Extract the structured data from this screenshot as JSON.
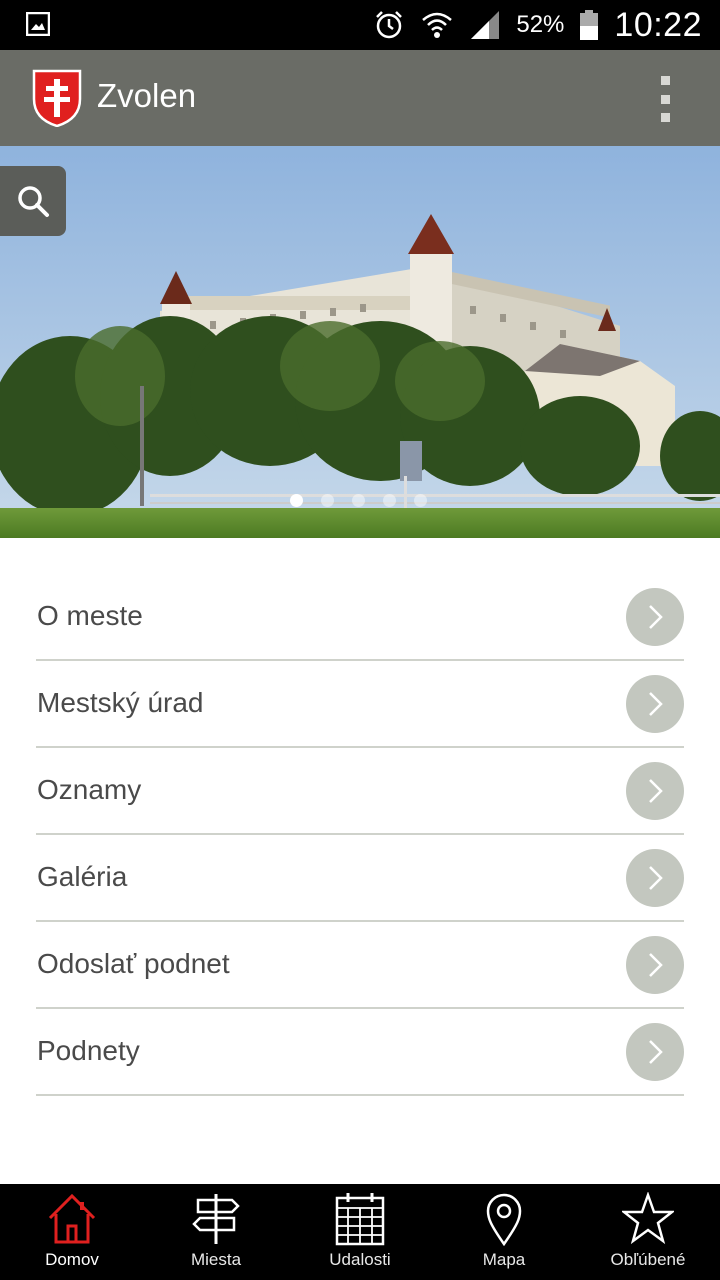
{
  "status_bar": {
    "icons": [
      "image-notification-icon",
      "alarm-icon",
      "wifi-icon",
      "signal-icon",
      "battery-icon"
    ],
    "battery": "52%",
    "time": "10:22"
  },
  "app_bar": {
    "title": "Zvolen",
    "logo": "coat-of-arms-icon",
    "menu_icon": "overflow-menu-icon"
  },
  "hero": {
    "search_icon": "search-icon",
    "slides_count": 5,
    "active_slide": 1
  },
  "menu": [
    {
      "label": "O meste"
    },
    {
      "label": "Mestský úrad"
    },
    {
      "label": "Oznamy"
    },
    {
      "label": "Galéria"
    },
    {
      "label": "Odoslať podnet"
    },
    {
      "label": "Podnety"
    }
  ],
  "bottom_nav": {
    "active_color": "#e0201f",
    "tabs": [
      {
        "label": "Domov",
        "icon": "home-icon",
        "active": true
      },
      {
        "label": "Miesta",
        "icon": "signpost-icon",
        "active": false
      },
      {
        "label": "Udalosti",
        "icon": "calendar-icon",
        "active": false
      },
      {
        "label": "Mapa",
        "icon": "map-pin-icon",
        "active": false
      },
      {
        "label": "Obľúbené",
        "icon": "star-icon",
        "active": false
      }
    ]
  },
  "colors": {
    "app_bar": "#6a6c66",
    "chevron_circle": "#c3c7bf",
    "divider": "#cfd2cb"
  }
}
